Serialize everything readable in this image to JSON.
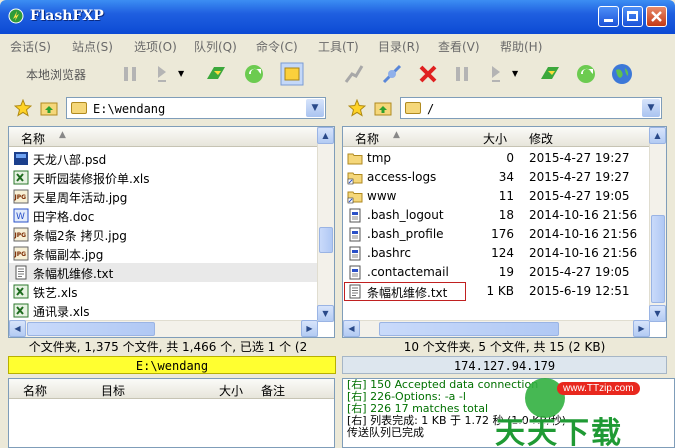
{
  "window": {
    "title": "FlashFXP"
  },
  "menu": [
    "会话(S)",
    "站点(S)",
    "选项(O)",
    "队列(Q)",
    "命令(C)",
    "工具(T)",
    "目录(R)",
    "查看(V)",
    "帮助(H)"
  ],
  "toolbar": {
    "local_browser_label": "本地浏览器"
  },
  "left": {
    "path": "E:\\wendang",
    "col_name": "名称",
    "files": [
      {
        "name": "天龙八部.psd",
        "icon": "psd-icon"
      },
      {
        "name": "天昕园装修报价单.xls",
        "icon": "xls-icon"
      },
      {
        "name": "天星周年活动.jpg",
        "icon": "jpg-icon"
      },
      {
        "name": "田字格.doc",
        "icon": "doc-icon"
      },
      {
        "name": "条幅2条 拷贝.jpg",
        "icon": "jpg-icon"
      },
      {
        "name": "条幅副本.jpg",
        "icon": "jpg-icon"
      },
      {
        "name": "条幅机维修.txt",
        "icon": "txt-icon"
      },
      {
        "name": "铁艺.xls",
        "icon": "xls-icon"
      },
      {
        "name": "通讯录.xls",
        "icon": "xls-icon"
      }
    ],
    "status_text": "个文件夹, 1,375 个文件, 共 1,466 个, 已选 1 个 (2",
    "path_status": "E:\\wendang"
  },
  "right": {
    "path": "/",
    "col_name": "名称",
    "col_size": "大小",
    "col_modified": "修改",
    "files": [
      {
        "name": "tmp",
        "size": "0",
        "modified": "2015-4-27 19:27",
        "icon": "folder-icon"
      },
      {
        "name": "access-logs",
        "size": "34",
        "modified": "2015-4-27 19:27",
        "icon": "folder-link-icon"
      },
      {
        "name": "www",
        "size": "11",
        "modified": "2015-4-27 19:05",
        "icon": "folder-link-icon"
      },
      {
        "name": ".bash_logout",
        "size": "18",
        "modified": "2014-10-16 21:56",
        "icon": "file-icon"
      },
      {
        "name": ".bash_profile",
        "size": "176",
        "modified": "2014-10-16 21:56",
        "icon": "file-icon"
      },
      {
        "name": ".bashrc",
        "size": "124",
        "modified": "2014-10-16 21:56",
        "icon": "file-icon"
      },
      {
        "name": ".contactemail",
        "size": "19",
        "modified": "2015-4-27 19:05",
        "icon": "file-icon"
      },
      {
        "name": "条幅机维修.txt",
        "size": "1 KB",
        "modified": "2015-6-19 12:51",
        "icon": "txt-icon"
      }
    ],
    "status_text": "10 个文件夹, 5 个文件, 共 15 (2 KB)",
    "ip_status": "174.127.94.179"
  },
  "queue": {
    "col_name": "名称",
    "col_target": "目标",
    "col_size": "大小",
    "col_note": "备注"
  },
  "log": [
    "[右] 150 Accepted data connection",
    "[右] 226-Options: -a -l",
    "[右] 226 17 matches total",
    "[右] 列表完成: 1 KB 于 1.72 秒 (1.0 KB/秒)",
    "传送队列已完成"
  ],
  "watermark": {
    "url": "www.TTzip.com",
    "text": "天天下载"
  }
}
